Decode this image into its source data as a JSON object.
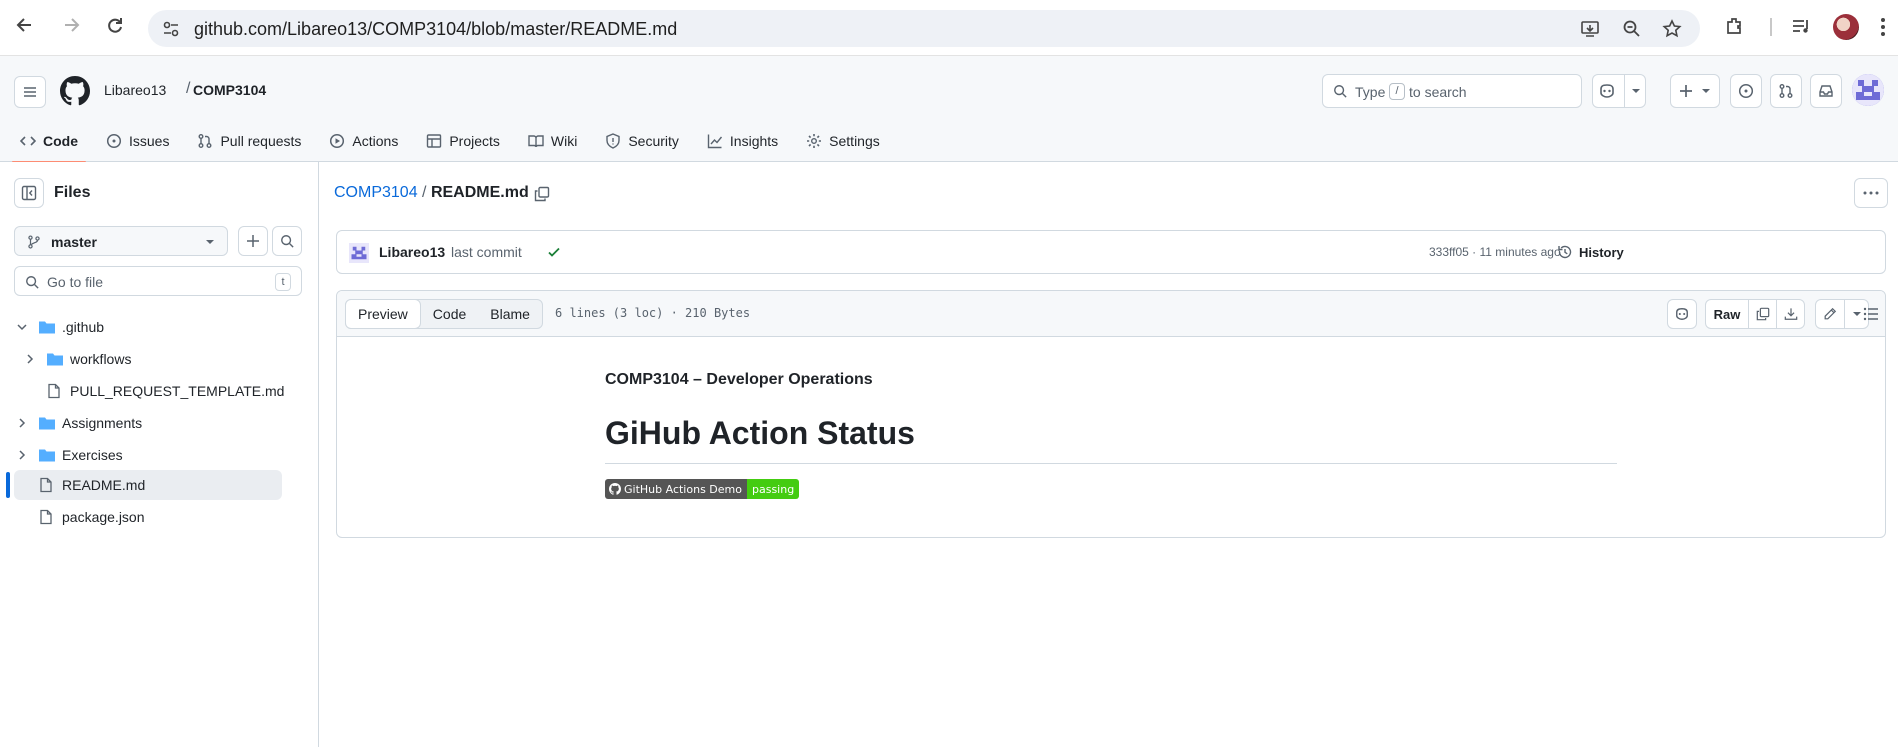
{
  "browser": {
    "url": "github.com/Libareo13/COMP3104/blob/master/README.md"
  },
  "header": {
    "owner": "Libareo13",
    "separator": "/",
    "repo": "COMP3104",
    "search_prefix": "Type",
    "search_key": "/",
    "search_suffix": "to search"
  },
  "repo_tabs": [
    {
      "label": "Code",
      "icon": "code-icon"
    },
    {
      "label": "Issues",
      "icon": "issue-icon"
    },
    {
      "label": "Pull requests",
      "icon": "pull-request-icon"
    },
    {
      "label": "Actions",
      "icon": "play-icon"
    },
    {
      "label": "Projects",
      "icon": "table-icon"
    },
    {
      "label": "Wiki",
      "icon": "book-icon"
    },
    {
      "label": "Security",
      "icon": "shield-icon"
    },
    {
      "label": "Insights",
      "icon": "graph-icon"
    },
    {
      "label": "Settings",
      "icon": "gear-icon"
    }
  ],
  "sidebar": {
    "title": "Files",
    "branch": "master",
    "goto_placeholder": "Go to file",
    "goto_key": "t",
    "tree": [
      {
        "label": ".github",
        "type": "folder",
        "expanded": true
      },
      {
        "label": "workflows",
        "type": "folder",
        "expanded": false
      },
      {
        "label": "PULL_REQUEST_TEMPLATE.md",
        "type": "file"
      },
      {
        "label": "Assignments",
        "type": "folder",
        "expanded": false
      },
      {
        "label": "Exercises",
        "type": "folder",
        "expanded": false
      },
      {
        "label": "README.md",
        "type": "file",
        "selected": true
      },
      {
        "label": "package.json",
        "type": "file"
      }
    ]
  },
  "main": {
    "path_repo": "COMP3104",
    "path_sep": "/",
    "path_file": "README.md",
    "commit": {
      "author": "Libareo13",
      "message": "last commit",
      "meta": "333ff05 · 11 minutes ago",
      "history_label": "History"
    },
    "file": {
      "views": [
        "Preview",
        "Code",
        "Blame"
      ],
      "meta": "6 lines (3 loc) · 210 Bytes",
      "raw_label": "Raw"
    },
    "readme": {
      "subtitle": "COMP3104 – Developer Operations",
      "heading": "GiHub Action Status",
      "badge_label": "GitHub Actions Demo",
      "badge_status": "passing"
    }
  },
  "colors": {
    "accent": "#0969da",
    "tab_underline": "#fd8c73",
    "folder": "#54aeff",
    "success": "#1a7f37",
    "badge_ok": "#44cc11",
    "badge_label_bg": "#555555"
  }
}
